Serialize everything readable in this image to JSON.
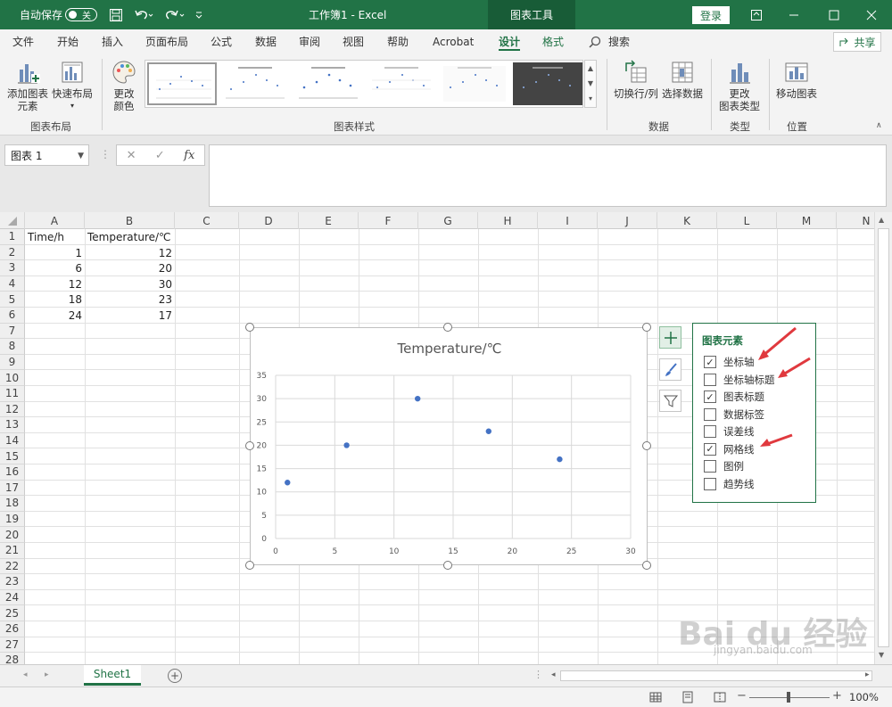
{
  "titlebar": {
    "autosave_label": "自动保存",
    "autosave_state": "关",
    "doc_title": "工作簿1 - Excel",
    "context_tab": "图表工具",
    "login": "登录"
  },
  "menu": {
    "tabs": [
      "文件",
      "开始",
      "插入",
      "页面布局",
      "公式",
      "数据",
      "审阅",
      "视图",
      "帮助",
      "Acrobat",
      "设计",
      "格式"
    ],
    "search": "搜索",
    "share": "共享"
  },
  "ribbon": {
    "add_element": [
      "添加图表",
      "元素"
    ],
    "quick_layout": "快速布局",
    "change_colors": [
      "更改",
      "颜色"
    ],
    "switch_row_col": "切换行/列",
    "select_data": "选择数据",
    "change_type": [
      "更改",
      "图表类型"
    ],
    "move_chart": "移动图表",
    "groups": {
      "layout": "图表布局",
      "styles": "图表样式",
      "data": "数据",
      "type": "类型",
      "location": "位置"
    }
  },
  "formula": {
    "namebox": "图表 1",
    "fx": "fx"
  },
  "grid": {
    "columns": [
      "A",
      "B",
      "C",
      "D",
      "E",
      "F",
      "G",
      "H",
      "I",
      "J",
      "K",
      "L",
      "M",
      "N"
    ],
    "rows": [
      "1",
      "2",
      "3",
      "4",
      "5",
      "6",
      "7",
      "8",
      "9",
      "10",
      "11",
      "12",
      "13",
      "14",
      "15",
      "16",
      "17",
      "18",
      "19",
      "20",
      "21",
      "22",
      "23",
      "24",
      "25",
      "26",
      "27",
      "28"
    ],
    "header": [
      "Time/h",
      "Temperature/℃"
    ],
    "data": [
      [
        "1",
        "12"
      ],
      [
        "6",
        "20"
      ],
      [
        "12",
        "30"
      ],
      [
        "18",
        "23"
      ],
      [
        "24",
        "17"
      ]
    ]
  },
  "chart_data": {
    "type": "scatter",
    "title": "Temperature/℃",
    "x": [
      1,
      6,
      12,
      18,
      24
    ],
    "y": [
      12,
      20,
      30,
      23,
      17
    ],
    "xlim": [
      0,
      30
    ],
    "ylim": [
      0,
      35
    ],
    "xticks": [
      "0",
      "5",
      "10",
      "15",
      "20",
      "25",
      "30"
    ],
    "yticks": [
      "0",
      "5",
      "10",
      "15",
      "20",
      "25",
      "30",
      "35"
    ],
    "grid": true,
    "point_color": "#4472c4"
  },
  "panel": {
    "title": "图表元素",
    "items": [
      {
        "label": "坐标轴",
        "checked": true
      },
      {
        "label": "坐标轴标题",
        "checked": false
      },
      {
        "label": "图表标题",
        "checked": true
      },
      {
        "label": "数据标签",
        "checked": false
      },
      {
        "label": "误差线",
        "checked": false
      },
      {
        "label": "网格线",
        "checked": true
      },
      {
        "label": "图例",
        "checked": false
      },
      {
        "label": "趋势线",
        "checked": false
      }
    ]
  },
  "sheets": {
    "active": "Sheet1"
  },
  "status": {
    "zoom": "100%"
  },
  "watermark": {
    "main": "Bai du 经验",
    "sub": "jingyan.baidu.com"
  },
  "colors": {
    "accent": "#217346",
    "arrow": "#e0393e"
  }
}
